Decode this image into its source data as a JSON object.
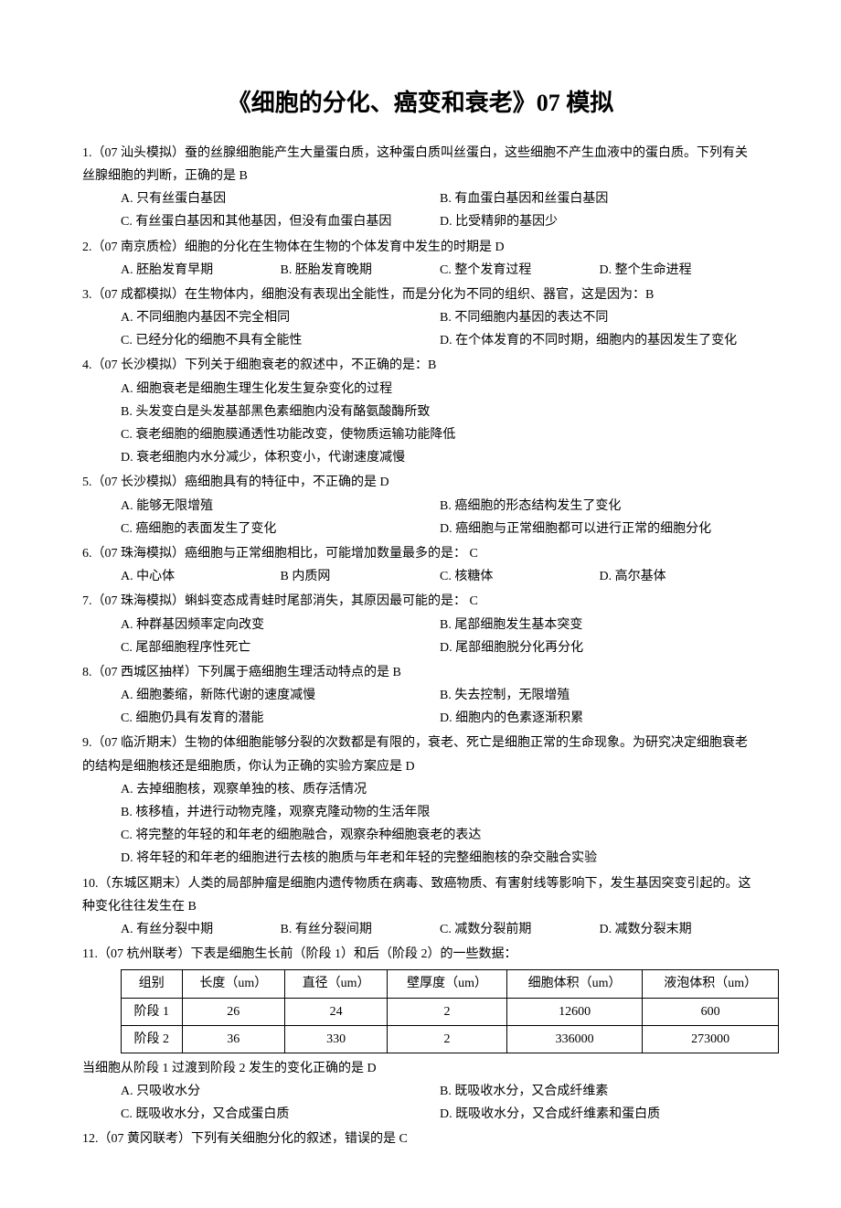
{
  "title": "《细胞的分化、癌变和衰老》07 模拟",
  "questions": [
    {
      "q": "1.（07 汕头模拟）蚕的丝腺细胞能产生大量蛋白质，这种蛋白质叫丝蛋白，这些细胞不产生血液中的蛋白质。下列有关丝腺细胞的判断，正确的是 B",
      "opts": [
        {
          "layout": "c2",
          "items": [
            "A. 只有丝蛋白基因",
            "B. 有血蛋白基因和丝蛋白基因"
          ]
        },
        {
          "layout": "c2",
          "items": [
            "C. 有丝蛋白基因和其他基因，但没有血蛋白基因",
            "D. 比受精卵的基因少"
          ]
        }
      ]
    },
    {
      "q": "2.（07 南京质检）细胞的分化在生物体在生物的个体发育中发生的时期是  D",
      "opts": [
        {
          "layout": "c4",
          "items": [
            "A. 胚胎发育早期",
            "B. 胚胎发育晚期",
            "C. 整个发育过程",
            "D. 整个生命进程"
          ]
        }
      ]
    },
    {
      "q": "3.（07 成都模拟）在生物体内，细胞没有表现出全能性，而是分化为不同的组织、器官，这是因为：B",
      "opts": [
        {
          "layout": "c2",
          "items": [
            "A. 不同细胞内基因不完全相同",
            "B. 不同细胞内基因的表达不同"
          ]
        },
        {
          "layout": "c2",
          "items": [
            "C. 已经分化的细胞不具有全能性",
            "D. 在个体发育的不同时期，细胞内的基因发生了变化"
          ]
        }
      ]
    },
    {
      "q": "4.（07 长沙模拟）下列关于细胞衰老的叙述中，不正确的是：B",
      "opts": [
        {
          "layout": "c1",
          "items": [
            "A. 细胞衰老是细胞生理生化发生复杂变化的过程"
          ]
        },
        {
          "layout": "c1",
          "items": [
            "B. 头发变白是头发基部黑色素细胞内没有酪氨酸酶所致"
          ]
        },
        {
          "layout": "c1",
          "items": [
            "C. 衰老细胞的细胞膜通透性功能改变，使物质运输功能降低"
          ]
        },
        {
          "layout": "c1",
          "items": [
            "D. 衰老细胞内水分减少，体积变小，代谢速度减慢"
          ]
        }
      ]
    },
    {
      "q": " 5.（07 长沙模拟）癌细胞具有的特征中，不正确的是 D",
      "opts": [
        {
          "layout": "c2",
          "items": [
            "A. 能够无限增殖",
            "B. 癌细胞的形态结构发生了变化"
          ]
        },
        {
          "layout": "c2",
          "items": [
            "C. 癌细胞的表面发生了变化",
            "D. 癌细胞与正常细胞都可以进行正常的细胞分化"
          ]
        }
      ]
    },
    {
      "q": "6.（07 珠海模拟）癌细胞与正常细胞相比，可能增加数量最多的是：  C",
      "opts": [
        {
          "layout": "c4",
          "items": [
            "A. 中心体",
            "B 内质网",
            "C. 核糖体",
            "D. 高尔基体"
          ]
        }
      ]
    },
    {
      "q": "7.（07 珠海模拟）蝌蚪变态成青蛙时尾部消失，其原因最可能的是：  C",
      "opts": [
        {
          "layout": "c2",
          "items": [
            "A. 种群基因频率定向改变",
            "B. 尾部细胞发生基本突变"
          ]
        },
        {
          "layout": "c2",
          "items": [
            "C. 尾部细胞程序性死亡",
            "D. 尾部细胞脱分化再分化"
          ]
        }
      ]
    },
    {
      "q": "8.（07 西城区抽样）下列属于癌细胞生理活动特点的是 B",
      "opts": [
        {
          "layout": "c2",
          "items": [
            "A. 细胞萎缩，新陈代谢的速度减慢",
            "B. 失去控制，无限增殖"
          ]
        },
        {
          "layout": "c2",
          "items": [
            "C. 细胞仍具有发育的潜能",
            "D. 细胞内的色素逐渐积累"
          ]
        }
      ]
    },
    {
      "q": "9.（07 临沂期末）生物的体细胞能够分裂的次数都是有限的，衰老、死亡是细胞正常的生命现象。为研究决定细胞衰老的结构是细胞核还是细胞质，你认为正确的实验方案应是 D",
      "opts": [
        {
          "layout": "c1",
          "items": [
            "A. 去掉细胞核，观察单独的核、质存活情况"
          ]
        },
        {
          "layout": "c1",
          "items": [
            "B. 核移植，并进行动物克隆，观察克隆动物的生活年限"
          ]
        },
        {
          "layout": "c1",
          "items": [
            "C. 将完整的年轻的和年老的细胞融合，观察杂种细胞衰老的表达"
          ]
        },
        {
          "layout": "c1",
          "items": [
            "D. 将年轻的和年老的细胞进行去核的胞质与年老和年轻的完整细胞核的杂交融合实验"
          ]
        }
      ]
    },
    {
      "q": "10.（东城区期末）人类的局部肿瘤是细胞内遗传物质在病毒、致癌物质、有害射线等影响下，发生基因突变引起的。这种变化往往发生在 B",
      "opts": [
        {
          "layout": "c4",
          "items": [
            "A. 有丝分裂中期",
            "B. 有丝分裂间期",
            "C. 减数分裂前期",
            "D. 减数分裂末期"
          ]
        }
      ]
    }
  ],
  "q11_intro": "11.（07 杭州联考）下表是细胞生长前（阶段 1）和后（阶段 2）的一些数据：",
  "q11_table": {
    "headers": [
      "组别",
      "长度（um）",
      "直径（um）",
      "壁厚度（um）",
      "细胞体积（um）",
      "液泡体积（um）"
    ],
    "rows": [
      [
        "阶段 1",
        "26",
        "24",
        "2",
        "12600",
        "600"
      ],
      [
        "阶段 2",
        "36",
        "330",
        "2",
        "336000",
        "273000"
      ]
    ]
  },
  "q11_after": "当细胞从阶段 1 过渡到阶段 2 发生的变化正确的是  D",
  "q11_opts": [
    {
      "layout": "c2",
      "items": [
        "A. 只吸收水分",
        "B. 既吸收水分，又合成纤维素"
      ]
    },
    {
      "layout": "c2",
      "items": [
        "C. 既吸收水分，又合成蛋白质",
        "D. 既吸收水分，又合成纤维素和蛋白质"
      ]
    }
  ],
  "q12": "12.（07 黄冈联考）下列有关细胞分化的叙述，错误的是 C"
}
